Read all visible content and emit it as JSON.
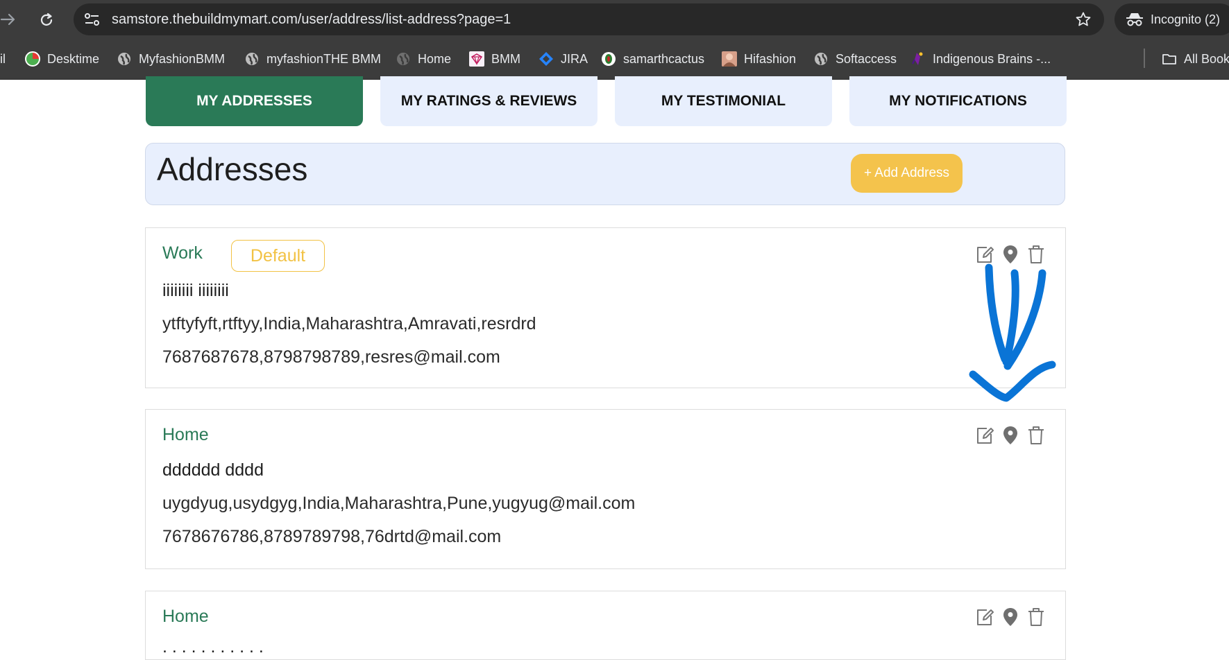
{
  "browser": {
    "url": "samstore.thebuildmymart.com/user/address/list-address?page=1",
    "incognito_label": "Incognito (2)",
    "bookmarks": [
      {
        "label": "il",
        "icon": "mail-icon"
      },
      {
        "label": "Desktime",
        "icon": "desktime-icon"
      },
      {
        "label": "MyfashionBMM",
        "icon": "globe-icon"
      },
      {
        "label": "myfashionTHE BMM",
        "icon": "globe-icon"
      },
      {
        "label": "Home",
        "icon": "globe-icon"
      },
      {
        "label": "BMM",
        "icon": "bmm-icon"
      },
      {
        "label": "JIRA",
        "icon": "jira-icon"
      },
      {
        "label": "samarthcactus",
        "icon": "cactus-icon"
      },
      {
        "label": "Hifashion",
        "icon": "hifashion-icon"
      },
      {
        "label": "Softaccess",
        "icon": "globe-icon"
      },
      {
        "label": "Indigenous Brains -...",
        "icon": "indigenous-icon"
      },
      {
        "label": "All Bookmarks",
        "icon": "folder-icon"
      }
    ]
  },
  "tabs": [
    {
      "label": "MY ADDRESSES",
      "active": true
    },
    {
      "label": "MY RATINGS & REVIEWS",
      "active": false
    },
    {
      "label": "MY TESTIMONIAL",
      "active": false
    },
    {
      "label": "MY NOTIFICATIONS",
      "active": false
    }
  ],
  "header": {
    "title": "Addresses",
    "add_button": "+ Add Address"
  },
  "addresses": [
    {
      "type": "Work",
      "default_badge": "Default",
      "name": "iiiiiiii iiiiiiii",
      "address": "ytftyfyft,rtftyy,India,Maharashtra,Amravati,resrdrd",
      "contact": "7687687678,8798798789,resres@mail.com"
    },
    {
      "type": "Home",
      "name": "dddddd dddd",
      "address": "uygdyug,usydgyg,India,Maharashtra,Pune,yugyug@mail.com",
      "contact": "7678676786,8789789798,76drtd@mail.com"
    },
    {
      "type": "Home",
      "name": ". . . . . . . . . . ."
    }
  ],
  "colors": {
    "brand_green": "#2a7a57",
    "tab_bg": "#e8effd",
    "accent_yellow": "#f4c34c",
    "annotation_blue": "#0a74d6"
  }
}
